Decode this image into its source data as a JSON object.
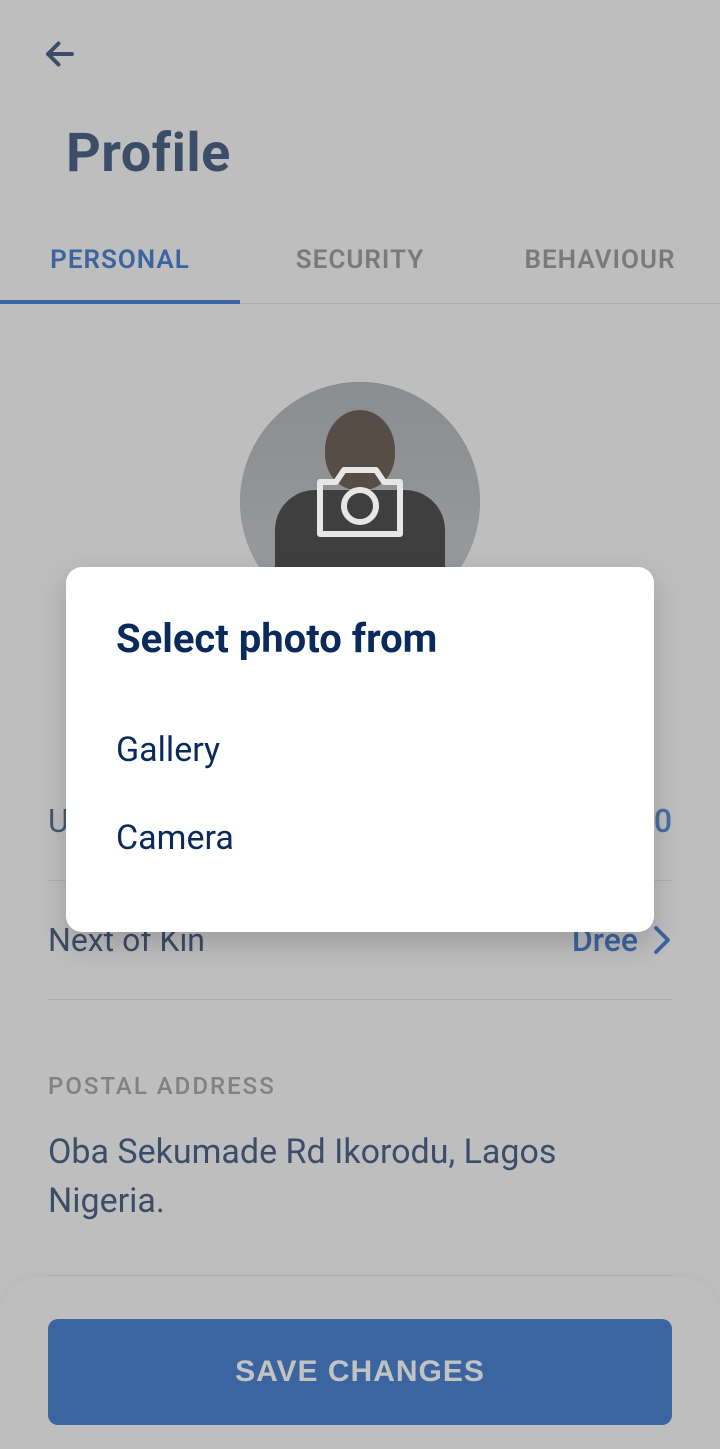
{
  "header": {
    "title": "Profile"
  },
  "tabs": [
    {
      "label": "PERSONAL",
      "active": true
    },
    {
      "label": "SECURITY",
      "active": false
    },
    {
      "label": "BEHAVIOUR",
      "active": false
    }
  ],
  "rows": {
    "row0": {
      "label": "U",
      "value": "0"
    },
    "next_of_kin": {
      "label": "Next of Kin",
      "value": "Dree"
    }
  },
  "postal": {
    "heading": "POSTAL ADDRESS",
    "address": "Oba Sekumade Rd Ikorodu, Lagos Nigeria."
  },
  "save_button": "SAVE CHANGES",
  "dialog": {
    "title": "Select photo from",
    "options": {
      "gallery": "Gallery",
      "camera": "Camera"
    }
  }
}
